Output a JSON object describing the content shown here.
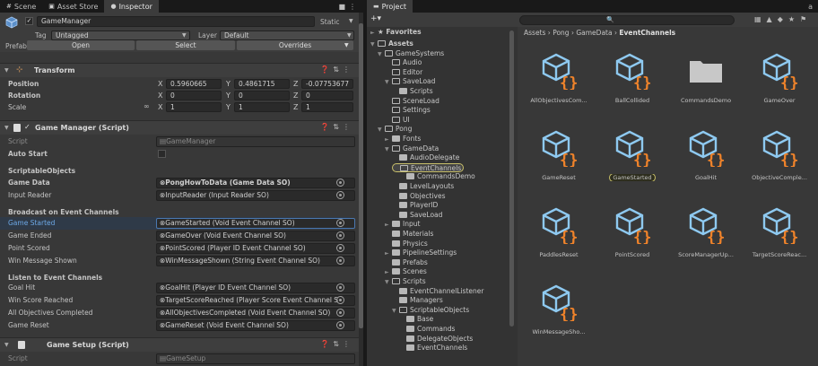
{
  "tabs_left": [
    {
      "label": "Scene",
      "icon": "#"
    },
    {
      "label": "Asset Store",
      "icon": "▣"
    },
    {
      "label": "Inspector",
      "icon": "●"
    }
  ],
  "tabs_right": [
    {
      "label": "Project",
      "icon": "▬"
    }
  ],
  "inspector": {
    "object_name": "GameManager",
    "static_label": "Static",
    "tag_label": "Tag",
    "tag_value": "Untagged",
    "layer_label": "Layer",
    "layer_value": "Default",
    "prefab_label": "Prefab",
    "prefab_open": "Open",
    "prefab_select": "Select",
    "prefab_overrides": "Overrides",
    "transform": {
      "title": "Transform",
      "position_label": "Position",
      "rotation_label": "Rotation",
      "scale_label": "Scale",
      "position": {
        "x": "0.5960665",
        "y": "0.4861715",
        "z": "-0.07753677"
      },
      "rotation": {
        "x": "0",
        "y": "0",
        "z": "0"
      },
      "scale": {
        "x": "1",
        "y": "1",
        "z": "1"
      }
    },
    "game_manager": {
      "title": "Game Manager (Script)",
      "script_label": "Script",
      "script_value": "GameManager",
      "auto_start_label": "Auto Start",
      "scriptable_section": "ScriptableObjects",
      "game_data_label": "Game Data",
      "game_data_value": "PongHowToData (Game Data SO)",
      "input_reader_label": "Input Reader",
      "input_reader_value": "InputReader (Input Reader SO)",
      "broadcast_section": "Broadcast on Event Channels",
      "game_started_label": "Game Started",
      "game_started_value": "GameStarted (Void Event Channel SO)",
      "game_ended_label": "Game Ended",
      "game_ended_value": "GameOver (Void Event Channel SO)",
      "point_scored_label": "Point Scored",
      "point_scored_value": "PointScored (Player ID Event Channel SO)",
      "win_msg_label": "Win Message Shown",
      "win_msg_value": "WinMessageShown (String Event Channel SO)",
      "listen_section": "Listen to Event Channels",
      "goal_hit_label": "Goal Hit",
      "goal_hit_value": "GoalHit (Player ID Event Channel SO)",
      "win_score_label": "Win Score Reached",
      "win_score_value": "TargetScoreReached (Player Score Event Channel S",
      "all_obj_label": "All Objectives Completed",
      "all_obj_value": "AllObjectivesCompleted (Void Event Channel SO)",
      "game_reset_label": "Game Reset",
      "game_reset_value": "GameReset (Void Event Channel SO)"
    },
    "game_setup": {
      "title": "Game Setup (Script)",
      "script_label": "Script",
      "script_value": "GameSetup"
    }
  },
  "project": {
    "favorites": "Favorites",
    "breadcrumb": [
      "Assets",
      "Pong",
      "GameData",
      "EventChannels"
    ],
    "tree": [
      {
        "label": "Assets",
        "depth": 0,
        "type": "open",
        "arrow": "▼",
        "bold": true
      },
      {
        "label": "GameSystems",
        "depth": 1,
        "type": "open",
        "arrow": "▼"
      },
      {
        "label": "Audio",
        "depth": 2,
        "type": "empty",
        "arrow": ""
      },
      {
        "label": "Editor",
        "depth": 2,
        "type": "empty",
        "arrow": ""
      },
      {
        "label": "SaveLoad",
        "depth": 2,
        "type": "open",
        "arrow": "▼"
      },
      {
        "label": "Scripts",
        "depth": 3,
        "type": "full",
        "arrow": ""
      },
      {
        "label": "SceneLoad",
        "depth": 2,
        "type": "empty",
        "arrow": ""
      },
      {
        "label": "Settings",
        "depth": 2,
        "type": "empty",
        "arrow": ""
      },
      {
        "label": "UI",
        "depth": 2,
        "type": "empty",
        "arrow": ""
      },
      {
        "label": "Pong",
        "depth": 1,
        "type": "open",
        "arrow": "▼"
      },
      {
        "label": "Fonts",
        "depth": 2,
        "type": "full",
        "arrow": "►"
      },
      {
        "label": "GameData",
        "depth": 2,
        "type": "open",
        "arrow": "▼"
      },
      {
        "label": "AudioDelegate",
        "depth": 3,
        "type": "full",
        "arrow": ""
      },
      {
        "label": "EventChannels",
        "depth": 3,
        "type": "open",
        "arrow": "",
        "selected": true
      },
      {
        "label": "CommandsDemo",
        "depth": 4,
        "type": "full",
        "arrow": ""
      },
      {
        "label": "LevelLayouts",
        "depth": 3,
        "type": "full",
        "arrow": ""
      },
      {
        "label": "Objectives",
        "depth": 3,
        "type": "full",
        "arrow": ""
      },
      {
        "label": "PlayerID",
        "depth": 3,
        "type": "full",
        "arrow": ""
      },
      {
        "label": "SaveLoad",
        "depth": 3,
        "type": "full",
        "arrow": ""
      },
      {
        "label": "Input",
        "depth": 2,
        "type": "full",
        "arrow": "►"
      },
      {
        "label": "Materials",
        "depth": 2,
        "type": "full",
        "arrow": ""
      },
      {
        "label": "Physics",
        "depth": 2,
        "type": "full",
        "arrow": ""
      },
      {
        "label": "PipelineSettings",
        "depth": 2,
        "type": "full",
        "arrow": "►"
      },
      {
        "label": "Prefabs",
        "depth": 2,
        "type": "full",
        "arrow": ""
      },
      {
        "label": "Scenes",
        "depth": 2,
        "type": "full",
        "arrow": "►"
      },
      {
        "label": "Scripts",
        "depth": 2,
        "type": "open",
        "arrow": "▼"
      },
      {
        "label": "EventChannelListener",
        "depth": 3,
        "type": "full",
        "arrow": ""
      },
      {
        "label": "Managers",
        "depth": 3,
        "type": "full",
        "arrow": ""
      },
      {
        "label": "ScriptableObjects",
        "depth": 3,
        "type": "open",
        "arrow": "▼"
      },
      {
        "label": "Base",
        "depth": 4,
        "type": "full",
        "arrow": ""
      },
      {
        "label": "Commands",
        "depth": 4,
        "type": "full",
        "arrow": ""
      },
      {
        "label": "DelegateObjects",
        "depth": 4,
        "type": "full",
        "arrow": ""
      },
      {
        "label": "EventChannels",
        "depth": 4,
        "type": "full",
        "arrow": ""
      }
    ],
    "assets": [
      {
        "label": "AllObjectivesCom...",
        "kind": "so"
      },
      {
        "label": "BallCollided",
        "kind": "so"
      },
      {
        "label": "CommandsDemo",
        "kind": "folder"
      },
      {
        "label": "GameOver",
        "kind": "so"
      },
      {
        "label": "GameReset",
        "kind": "so"
      },
      {
        "label": "GameStarted",
        "kind": "so",
        "highlight": true
      },
      {
        "label": "GoalHit",
        "kind": "so"
      },
      {
        "label": "ObjectiveComple...",
        "kind": "so"
      },
      {
        "label": "PaddlesReset",
        "kind": "so"
      },
      {
        "label": "PointScored",
        "kind": "so"
      },
      {
        "label": "ScoreManagerUp...",
        "kind": "so"
      },
      {
        "label": "TargetScoreReac...",
        "kind": "so"
      },
      {
        "label": "WinMessageSho...",
        "kind": "so"
      }
    ]
  }
}
